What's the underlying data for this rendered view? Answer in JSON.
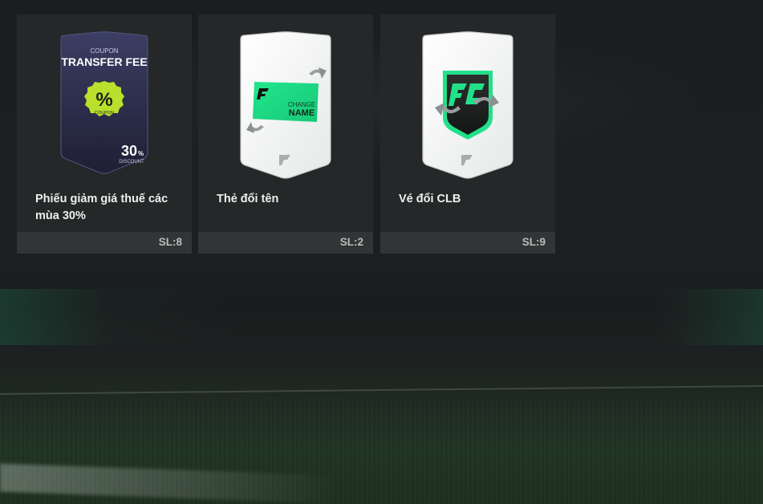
{
  "items": [
    {
      "name": "Phiếu giảm giá thuế các mùa 30%",
      "quantity": "SL:8",
      "card": {
        "top_label": "COUPON",
        "main_label": "TRANSFER FEE",
        "badge_symbol": "%",
        "badge_label": "COUPON",
        "discount_value": "30",
        "discount_unit": "%",
        "discount_label": "DISCOUNT"
      }
    },
    {
      "name": "Thẻ đổi tên",
      "quantity": "SL:2",
      "card": {
        "line1": "CHANGE",
        "line2": "NAME"
      }
    },
    {
      "name": "Vé đổi CLB",
      "quantity": "SL:9"
    }
  ],
  "colors": {
    "tile": "#252728",
    "tile_footer": "#323536",
    "accent_green": "#2ee68a",
    "coupon_badge": "#b8e02c"
  }
}
